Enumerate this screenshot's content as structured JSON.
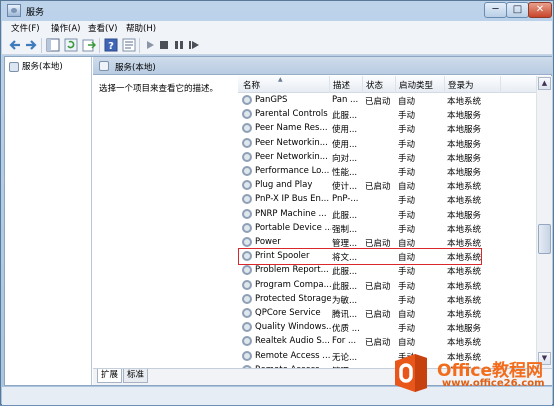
{
  "window": {
    "title": "服务",
    "min_glyph": "─",
    "max_glyph": "□",
    "close_glyph": "✕"
  },
  "menubar": {
    "items": [
      {
        "label": "文件(F)"
      },
      {
        "label": "操作(A)"
      },
      {
        "label": "查看(V)"
      },
      {
        "label": "帮助(H)"
      }
    ]
  },
  "toolbar": {
    "icons": [
      "back-icon",
      "forward-icon",
      "show-hide-tree-icon",
      "refresh-icon",
      "export-icon",
      "help-icon",
      "properties-icon",
      "play-icon",
      "stop-icon",
      "pause-icon",
      "restart-icon"
    ]
  },
  "tree": {
    "root_label": "服务(本地)"
  },
  "pane": {
    "title": "服务(本地)",
    "description": "选择一个项目来查看它的描述。"
  },
  "list": {
    "columns": [
      "名称",
      "描述",
      "状态",
      "启动类型",
      "登录为"
    ],
    "rows": [
      {
        "name": "PanGPS",
        "desc": "Pan ...",
        "status": "已启动",
        "startup": "自动",
        "logon": "本地系统"
      },
      {
        "name": "Parental Controls",
        "desc": "此服...",
        "status": "",
        "startup": "手动",
        "logon": "本地服务"
      },
      {
        "name": "Peer Name Res...",
        "desc": "使用...",
        "status": "",
        "startup": "手动",
        "logon": "本地服务"
      },
      {
        "name": "Peer Networkin...",
        "desc": "使用...",
        "status": "",
        "startup": "手动",
        "logon": "本地服务"
      },
      {
        "name": "Peer Networkin...",
        "desc": "向对...",
        "status": "",
        "startup": "手动",
        "logon": "本地服务"
      },
      {
        "name": "Performance Lo...",
        "desc": "性能...",
        "status": "",
        "startup": "手动",
        "logon": "本地服务"
      },
      {
        "name": "Plug and Play",
        "desc": "使计...",
        "status": "已启动",
        "startup": "自动",
        "logon": "本地系统"
      },
      {
        "name": "PnP-X IP Bus En...",
        "desc": "PnP-...",
        "status": "",
        "startup": "手动",
        "logon": "本地系统"
      },
      {
        "name": "PNRP Machine ...",
        "desc": "此服...",
        "status": "",
        "startup": "手动",
        "logon": "本地服务"
      },
      {
        "name": "Portable Device ...",
        "desc": "强制...",
        "status": "",
        "startup": "手动",
        "logon": "本地系统"
      },
      {
        "name": "Power",
        "desc": "管理...",
        "status": "已启动",
        "startup": "自动",
        "logon": "本地系统"
      },
      {
        "name": "Print Spooler",
        "desc": "将文...",
        "status": "",
        "startup": "自动",
        "logon": "本地系统"
      },
      {
        "name": "Problem Report...",
        "desc": "此服...",
        "status": "",
        "startup": "手动",
        "logon": "本地系统"
      },
      {
        "name": "Program Compa...",
        "desc": "此服...",
        "status": "已启动",
        "startup": "手动",
        "logon": "本地系统"
      },
      {
        "name": "Protected Storage",
        "desc": "为敏...",
        "status": "",
        "startup": "手动",
        "logon": "本地系统"
      },
      {
        "name": "QPCore Service",
        "desc": "腾讯...",
        "status": "已启动",
        "startup": "自动",
        "logon": "本地系统"
      },
      {
        "name": "Quality Windows...",
        "desc": "优质 ...",
        "status": "",
        "startup": "手动",
        "logon": "本地服务"
      },
      {
        "name": "Realtek Audio S...",
        "desc": "For ...",
        "status": "已启动",
        "startup": "自动",
        "logon": "本地系统"
      },
      {
        "name": "Remote Access ...",
        "desc": "无论...",
        "status": "",
        "startup": "手动",
        "logon": "本地系统"
      },
      {
        "name": "Remote Access ...",
        "desc": "管理...",
        "status": "",
        "startup": "手动",
        "logon": "本地系统"
      }
    ],
    "highlighted_row": "Print Spooler",
    "highlight_color": "#d8282a"
  },
  "tabs": [
    {
      "label": "扩展"
    },
    {
      "label": "标准"
    }
  ],
  "watermark": {
    "title": "Office教程网",
    "url": "www.office26.com",
    "accent": "#f26c1c"
  }
}
